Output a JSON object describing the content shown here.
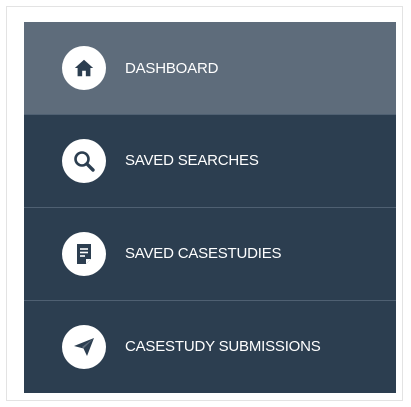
{
  "menu": {
    "items": [
      {
        "label": "DASHBOARD",
        "icon": "home-icon",
        "active": true
      },
      {
        "label": "SAVED SEARCHES",
        "icon": "search-icon",
        "active": false
      },
      {
        "label": "SAVED CASESTUDIES",
        "icon": "document-icon",
        "active": false
      },
      {
        "label": "CASESTUDY SUBMISSIONS",
        "icon": "paper-plane-icon",
        "active": false
      }
    ]
  },
  "colors": {
    "menu_bg": "#2c3e50",
    "active_bg": "#5e6c7b",
    "divider": "#4f6072",
    "text": "#ffffff"
  }
}
